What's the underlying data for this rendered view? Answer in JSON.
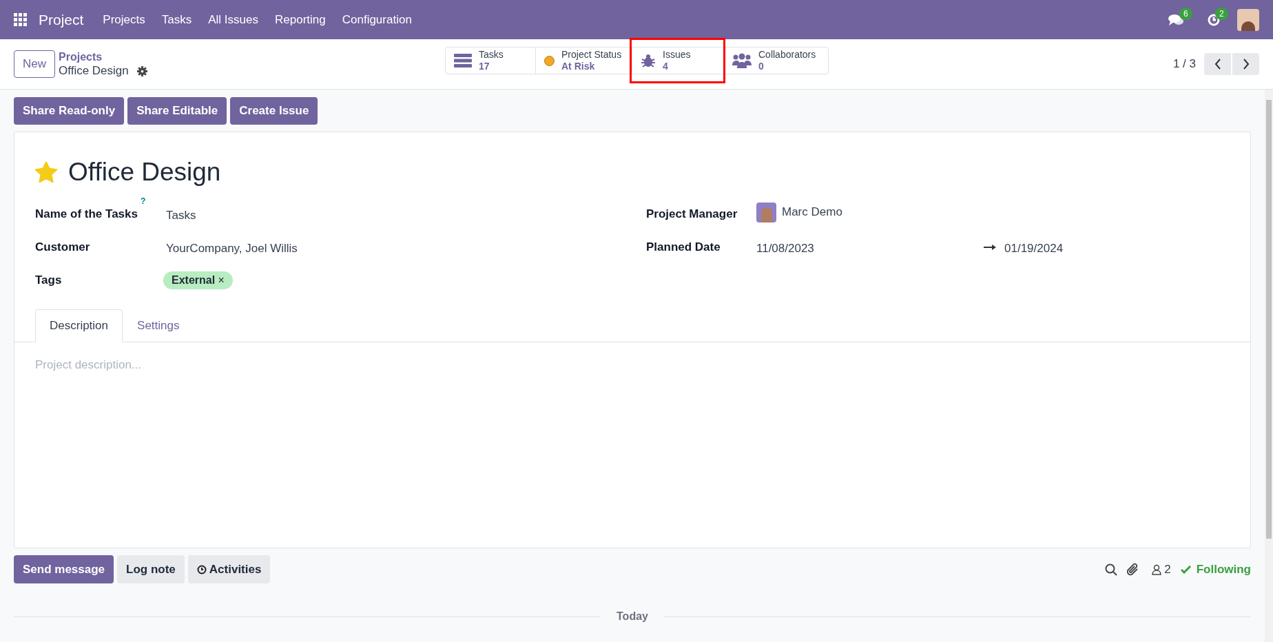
{
  "navbar": {
    "app": "Project",
    "menu": [
      "Projects",
      "Tasks",
      "All Issues",
      "Reporting",
      "Configuration"
    ],
    "messages_count": "6",
    "activities_count": "2"
  },
  "control_panel": {
    "new_button": "New",
    "breadcrumb_parent": "Projects",
    "breadcrumb_current": "Office Design",
    "pager": "1 / 3",
    "stat_buttons": [
      {
        "kind": "tasks",
        "label": "Tasks",
        "value": "17",
        "highlighted": false
      },
      {
        "kind": "status",
        "label": "Project Status",
        "value": "At Risk",
        "color": "#f3a629",
        "highlighted": false
      },
      {
        "kind": "issues",
        "label": "Issues",
        "value": "4",
        "highlighted": true
      },
      {
        "kind": "collaborators",
        "label": "Collaborators",
        "value": "0",
        "highlighted": false
      }
    ]
  },
  "actions": [
    "Share Read-only",
    "Share Editable",
    "Create Issue"
  ],
  "form": {
    "title": "Office Design",
    "favorite": true,
    "left_fields": [
      {
        "kind": "text",
        "label": "Name of the Tasks",
        "help": "?",
        "value": "Tasks"
      },
      {
        "kind": "text",
        "label": "Customer",
        "value": "YourCompany, Joel Willis"
      },
      {
        "kind": "tags",
        "label": "Tags",
        "tags": [
          {
            "text": "External",
            "remove": "×",
            "color": "#b8ecc1"
          }
        ]
      }
    ],
    "right_fields": [
      {
        "kind": "user",
        "label": "Project Manager",
        "value": "Marc Demo"
      },
      {
        "kind": "daterange",
        "label": "Planned Date",
        "start": "11/08/2023",
        "end": "01/19/2024"
      }
    ],
    "tabs": [
      {
        "label": "Description",
        "selected": true
      },
      {
        "label": "Settings",
        "selected": false
      }
    ],
    "description_placeholder": "Project description..."
  },
  "chatter": {
    "buttons": [
      {
        "label": "Send message",
        "kind": "primary"
      },
      {
        "label": "Log note",
        "kind": "secondary"
      },
      {
        "label": "Activities",
        "kind": "activities"
      }
    ],
    "followers_count": "2",
    "following": "Following",
    "date_separator": "Today"
  }
}
